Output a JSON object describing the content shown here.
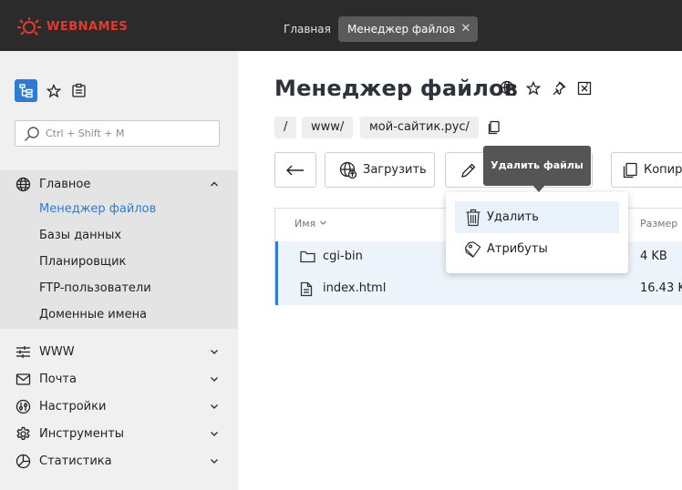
{
  "header": {
    "logo_text": "WEBNAMES",
    "tabs": [
      {
        "label": "Главная",
        "active": false
      },
      {
        "label": "Менеджер файлов",
        "active": true
      }
    ],
    "close_glyph": "✕",
    "brand_color": "#e8372c"
  },
  "sidebar": {
    "top_icons": [
      "tree-icon",
      "star-icon",
      "clipboard-icon"
    ],
    "search": {
      "value": "",
      "placeholder": "Ctrl + Shift + M"
    },
    "groups": [
      {
        "label": "Главное",
        "icon": "globe-icon",
        "expanded": true,
        "items": [
          {
            "label": "Менеджер файлов",
            "active": true
          },
          {
            "label": "Базы данных",
            "active": false
          },
          {
            "label": "Планировщик",
            "active": false
          },
          {
            "label": "FTP-пользователи",
            "active": false
          },
          {
            "label": "Доменные имена",
            "active": false
          }
        ]
      },
      {
        "label": "WWW",
        "icon": "sliders-icon",
        "expanded": false
      },
      {
        "label": "Почта",
        "icon": "mail-icon",
        "expanded": false
      },
      {
        "label": "Настройки",
        "icon": "settings-icon",
        "expanded": false
      },
      {
        "label": "Инструменты",
        "icon": "gear-icon",
        "expanded": false
      },
      {
        "label": "Статистика",
        "icon": "chart-pie-icon",
        "expanded": false
      }
    ]
  },
  "main": {
    "title": "Менеджер файлов",
    "breadcrumbs": [
      "/",
      "www/",
      "мой-сайтик.рус/"
    ],
    "toolbar": {
      "upload_label": "Загрузить",
      "copy_label": "Копир"
    },
    "table": {
      "columns": {
        "name": "Имя",
        "size": "Размер"
      },
      "rows": [
        {
          "type": "folder",
          "name": "cgi-bin",
          "size": "4 KB"
        },
        {
          "type": "file",
          "name": "index.html",
          "size": "16.43 K"
        }
      ]
    },
    "dropdown": {
      "items": [
        {
          "label": "Удалить",
          "icon": "trash-icon",
          "highlighted": true
        },
        {
          "label": "Атрибуты",
          "icon": "tag-icon",
          "highlighted": false
        }
      ]
    },
    "tooltip": "Удалить файлы",
    "accent_color": "#2e7bd6"
  }
}
